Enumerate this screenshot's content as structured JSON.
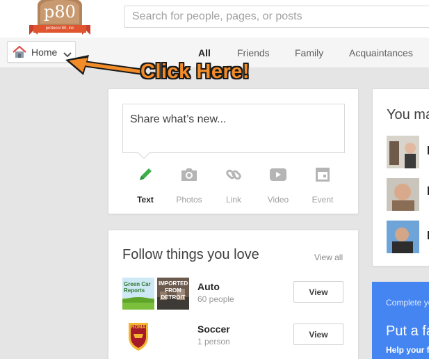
{
  "logo": {
    "text": "p80",
    "tagline": "protocol 80, inc"
  },
  "search": {
    "placeholder": "Search for people, pages, or posts"
  },
  "home_menu": {
    "label": "Home"
  },
  "stream_tabs": [
    {
      "label": "All",
      "active": true
    },
    {
      "label": "Friends"
    },
    {
      "label": "Family"
    },
    {
      "label": "Acquaintances"
    }
  ],
  "callout": {
    "text": "Click Here!",
    "color": "#f28c28"
  },
  "share": {
    "placeholder": "Share what’s new...",
    "types": [
      {
        "label": "Text",
        "icon": "pencil-icon",
        "active": true
      },
      {
        "label": "Photos",
        "icon": "camera-icon"
      },
      {
        "label": "Link",
        "icon": "link-icon"
      },
      {
        "label": "Video",
        "icon": "video-icon"
      },
      {
        "label": "Event",
        "icon": "event-icon"
      }
    ]
  },
  "follow": {
    "title": "Follow things you love",
    "view_all": "View all",
    "topics": [
      {
        "name": "Auto",
        "count": "60 people",
        "button": "View",
        "thumbs": [
          "Green Car Reports",
          "IMPORTED FROM DETROIT"
        ]
      },
      {
        "name": "Soccer",
        "count": "1 person",
        "button": "View",
        "thumbs": [
          "ROMA"
        ]
      }
    ]
  },
  "people": {
    "title": "You ma"
  },
  "promo": {
    "complete": "Complete yo",
    "headline": "Put a fa",
    "help": "Help your f",
    "color": "#4585f1"
  }
}
